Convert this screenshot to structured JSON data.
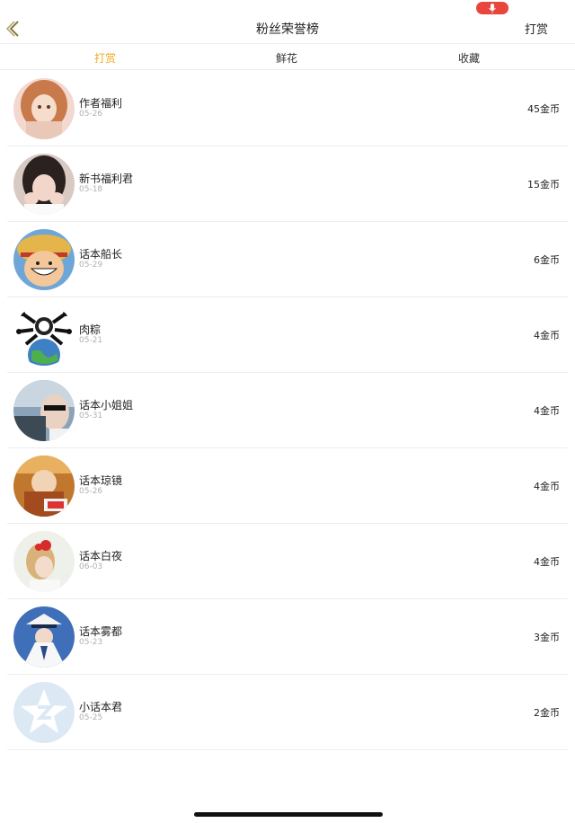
{
  "header": {
    "title": "粉丝荣誉榜",
    "reward_label": "打赏"
  },
  "tabs": [
    {
      "label": "打赏",
      "active": true
    },
    {
      "label": "鲜花",
      "active": false
    },
    {
      "label": "收藏",
      "active": false
    }
  ],
  "accent_color": "#f0a81e",
  "mic_color": "#e8453c",
  "fans": [
    {
      "name": "作者福利",
      "date": "05-26",
      "amount": "45金币"
    },
    {
      "name": "新书福利君",
      "date": "05-18",
      "amount": "15金币"
    },
    {
      "name": "话本船长",
      "date": "05-29",
      "amount": "6金币"
    },
    {
      "name": "肉粽",
      "date": "05-21",
      "amount": "4金币"
    },
    {
      "name": "话本小姐姐",
      "date": "05-31",
      "amount": "4金币"
    },
    {
      "name": "话本琼镜",
      "date": "05-26",
      "amount": "4金币"
    },
    {
      "name": "话本白夜",
      "date": "06-03",
      "amount": "4金币"
    },
    {
      "name": "话本雾都",
      "date": "05-23",
      "amount": "3金币"
    },
    {
      "name": "小话本君",
      "date": "05-25",
      "amount": "2金币"
    }
  ]
}
